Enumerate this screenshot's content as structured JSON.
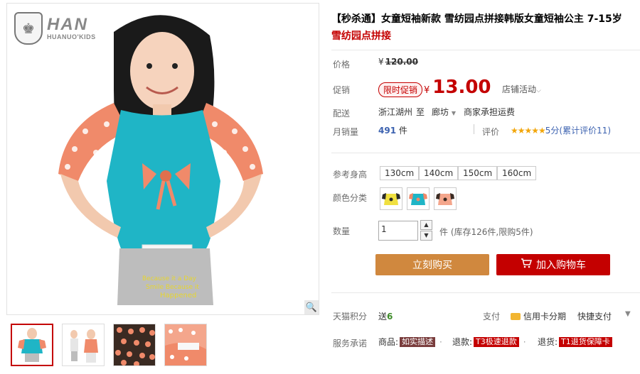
{
  "brand": {
    "logo_big": "HAN",
    "logo_small": "HUANUO'KIDS"
  },
  "product": {
    "title": "【秒杀通】女童短袖新款 雪纺园点拼接韩版女童短袖公主 7-15岁",
    "subtitle": "雪纺园点拼接"
  },
  "price": {
    "label": "价格",
    "original_symbol": "¥",
    "original_value": "120.00",
    "promo_label": "促销",
    "promo_tag": "限时促销",
    "current_symbol": "¥",
    "current_value": "13.00",
    "shop_activity": "店铺活动"
  },
  "shipping": {
    "label": "配送",
    "from": "浙江湖州",
    "to_word": "至",
    "to": "廊坊",
    "fee": "商家承担运费"
  },
  "sales": {
    "label": "月销量",
    "count": "491",
    "unit": "件",
    "rating_label": "评价",
    "stars": "★★★★★",
    "rating_text": "5分(累计评价11)"
  },
  "options": {
    "size_label": "参考身高",
    "sizes": [
      "130cm",
      "140cm",
      "150cm",
      "160cm"
    ],
    "color_label": "颜色分类",
    "qty_label": "数量",
    "qty_value": "1",
    "stock_text": "件 (库存126件,限购5件)"
  },
  "actions": {
    "buy_now": "立刻购买",
    "add_cart": "加入购物车"
  },
  "extras": {
    "points_label": "天猫积分",
    "points_prefix": "送",
    "points_value": "6",
    "pay_label": "支付",
    "credit": "信用卡分期",
    "quick_pay": "快捷支付",
    "service_label": "服务承诺",
    "goods_prefix": "商品:",
    "goods_tag": "如实描述",
    "refund_prefix": "退款:",
    "refund_tag": "T3极速退款",
    "return_prefix": "退货:",
    "return_tag": "T1退货保障卡"
  },
  "colors": {
    "accent_red": "#c40000",
    "buy_orange": "#d0883e",
    "shirt_teal": "#1fb5c6",
    "sleeve_coral": "#f08a6a"
  },
  "icons": [
    "zoom-icon",
    "cart-icon",
    "credit-card-icon",
    "chevron-down-icon"
  ]
}
